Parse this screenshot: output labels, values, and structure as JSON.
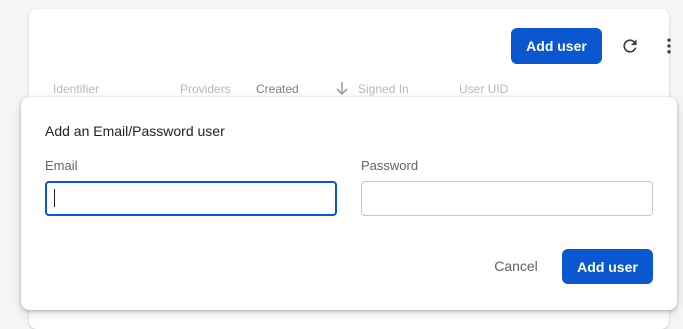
{
  "toolbar": {
    "add_user_label": "Add user",
    "refresh_icon": "refresh-icon",
    "more_icon": "more-vert-icon"
  },
  "table": {
    "columns": [
      "Identifier",
      "Providers",
      "Created",
      "Signed In",
      "User UID"
    ],
    "sorted_column": "Created",
    "sort_icon": "arrow-down-icon"
  },
  "dialog": {
    "title": "Add an Email/Password user",
    "email_label": "Email",
    "email_value": "",
    "password_label": "Password",
    "password_value": "",
    "cancel_label": "Cancel",
    "add_user_label": "Add user"
  },
  "colors": {
    "primary": "#0b57d0",
    "text": "#202124",
    "muted": "#5f6368",
    "faint": "#b5b8bc"
  }
}
